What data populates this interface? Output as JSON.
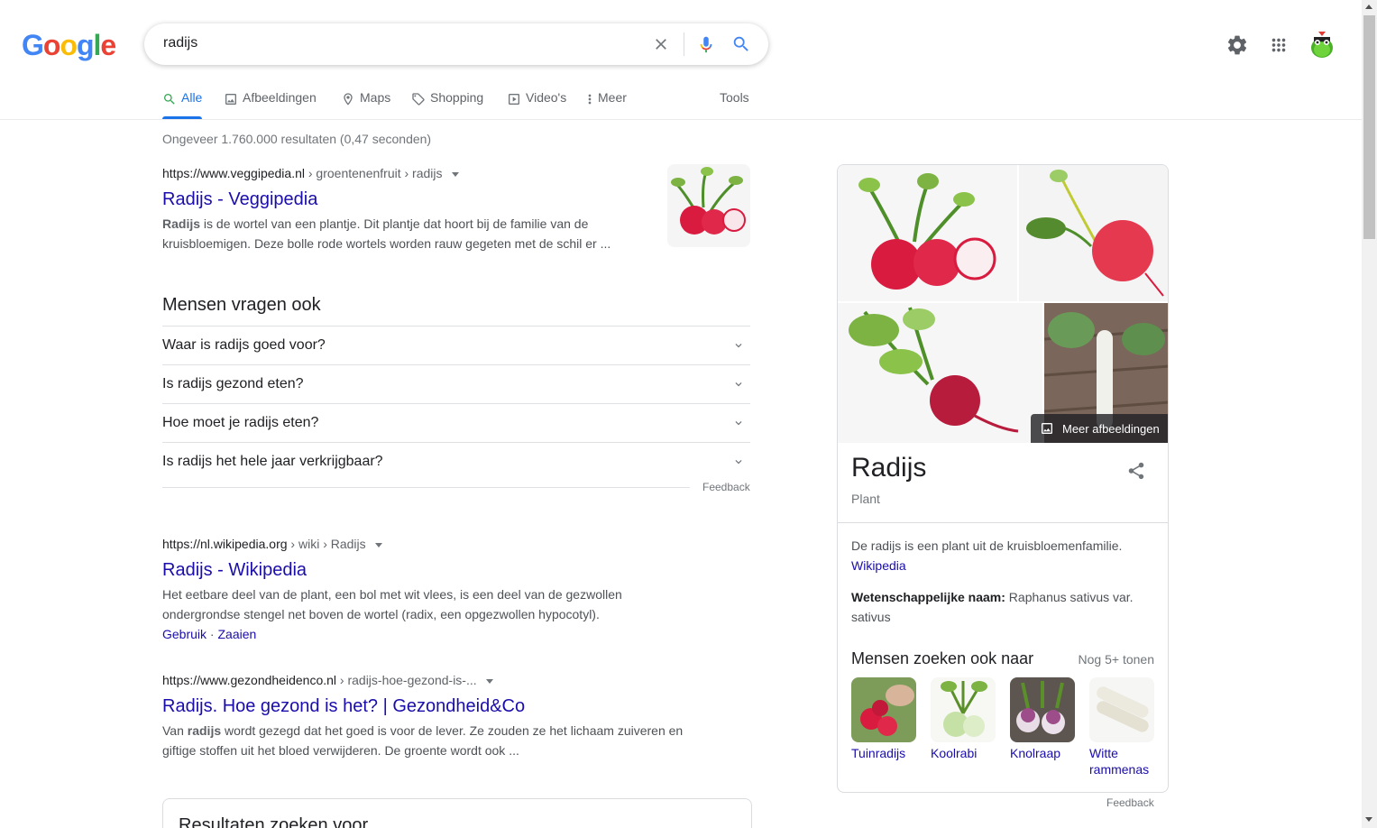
{
  "logo": {
    "letters": [
      "G",
      "o",
      "o",
      "g",
      "l",
      "e"
    ],
    "colors": [
      "#4285f4",
      "#ea4335",
      "#fbbc05",
      "#4285f4",
      "#34a853",
      "#ea4335"
    ]
  },
  "search": {
    "value": "radijs"
  },
  "tabs": [
    {
      "label": "Alle",
      "icon": "search-icon",
      "active": true
    },
    {
      "label": "Afbeeldingen",
      "icon": "image-icon"
    },
    {
      "label": "Maps",
      "icon": "map-pin-icon"
    },
    {
      "label": "Shopping",
      "icon": "tag-icon"
    },
    {
      "label": "Video's",
      "icon": "play-icon"
    },
    {
      "label": "Meer",
      "icon": "more-vert-icon"
    }
  ],
  "tools_label": "Tools",
  "stats": "Ongeveer 1.760.000 resultaten (0,47 seconden)",
  "results": [
    {
      "domain": "https://www.veggipedia.nl",
      "crumbs": " › groentenenfruit › radijs",
      "title": "Radijs - Veggipedia",
      "snippet_bold": "Radijs",
      "snippet_rest": " is de wortel van een plantje. Dit plantje dat hoort bij de familie van de kruisbloemigen. Deze bolle rode wortels worden rauw gegeten met de schil er ..."
    },
    {
      "domain": "https://nl.wikipedia.org",
      "crumbs": " › wiki › Radijs",
      "title": "Radijs - Wikipedia",
      "snippet": "Het eetbare deel van de plant, een bol met wit vlees, is een deel van de gezwollen ondergrondse stengel net boven de wortel (radix, een opgezwollen hypocotyl).",
      "sitelinks": [
        "Gebruik",
        "Zaaien"
      ],
      "sitelink_sep": " · "
    },
    {
      "domain": "https://www.gezondheidenco.nl",
      "crumbs": " › radijs-hoe-gezond-is-...",
      "title": "Radijs. Hoe gezond is het? | Gezondheid&Co",
      "snippet_pre": "Van ",
      "snippet_bold": "radijs",
      "snippet_rest": " wordt gezegd dat het goed is voor de lever. Ze zouden ze het lichaam zuiveren en giftige stoffen uit het bloed verwijderen. De groente wordt ook ..."
    }
  ],
  "paa": {
    "title": "Mensen vragen ook",
    "questions": [
      "Waar is radijs goed voor?",
      "Is radijs gezond eten?",
      "Hoe moet je radijs eten?",
      "Is radijs het hele jaar verkrijgbaar?"
    ],
    "feedback": "Feedback"
  },
  "results_for": "Resultaten zoeken voor",
  "kp": {
    "more_images": "Meer afbeeldingen",
    "title": "Radijs",
    "subtitle": "Plant",
    "description": "De radijs is een plant uit de kruisbloemenfamilie.",
    "source": "Wikipedia",
    "sci_label": "Wetenschappelijke naam:",
    "sci_value": " Raphanus sativus var. sativus",
    "also_title": "Mensen zoeken ook naar",
    "also_more": "Nog 5+ tonen",
    "also_items": [
      "Tuinradijs",
      "Koolrabi",
      "Knolraap",
      "Witte rammenas"
    ],
    "feedback": "Feedback"
  }
}
